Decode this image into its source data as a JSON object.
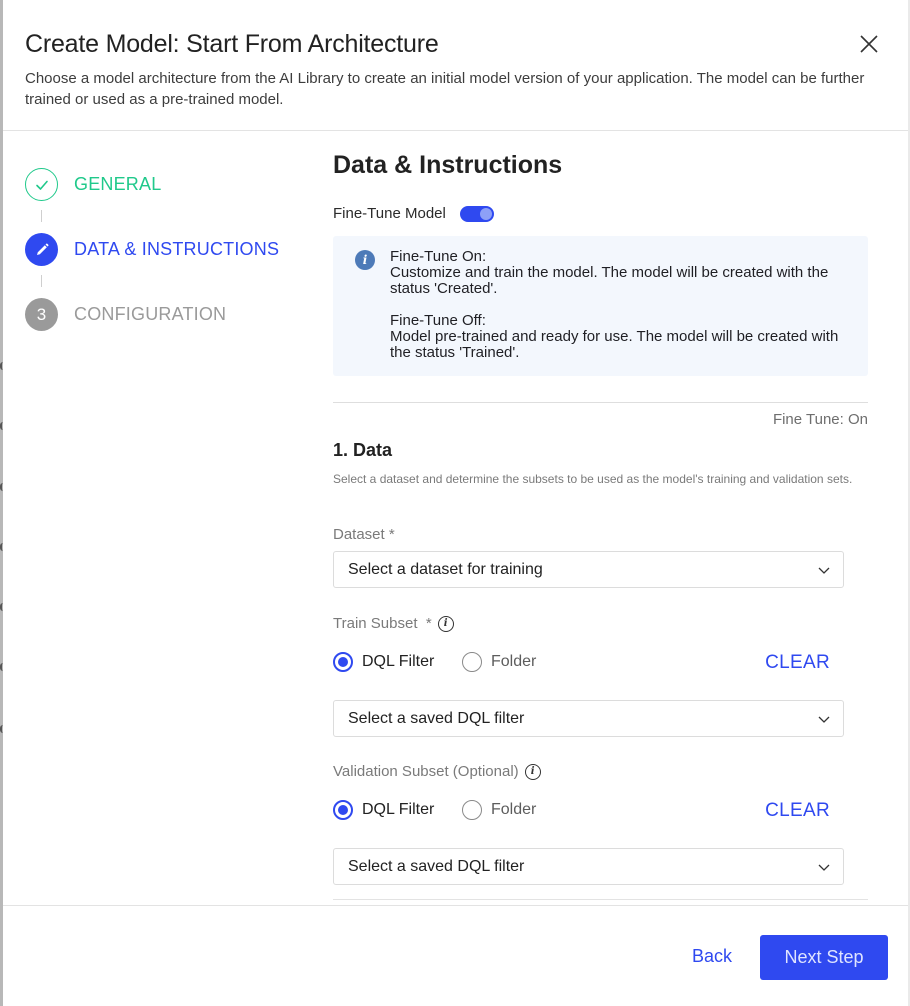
{
  "dialog": {
    "title": "Create Model: Start From Architecture",
    "subtitle": "Choose a model architecture from the AI Library to create an initial model version of your application. The model can be further trained or used as a pre-trained model.",
    "close_icon": "close-icon"
  },
  "stepper": {
    "steps": [
      {
        "label": "GENERAL",
        "state": "completed",
        "icon": "check-icon"
      },
      {
        "label": "DATA & INSTRUCTIONS",
        "state": "active",
        "icon": "pencil-icon"
      },
      {
        "label": "CONFIGURATION",
        "state": "pending",
        "number": "3"
      }
    ]
  },
  "main": {
    "section_title": "Data & Instructions",
    "fine_tune": {
      "label": "Fine-Tune Model",
      "enabled": true
    },
    "info": {
      "icon": "info-icon",
      "on_heading": "Fine-Tune On:",
      "on_text": "Customize and train the model. The model will be created with the status 'Created'.",
      "off_heading": "Fine-Tune Off:",
      "off_text": "Model pre-trained and ready for use. The model will be created with the status 'Trained'."
    },
    "fine_tune_status": "Fine Tune: On",
    "data_section": {
      "title": "1. Data",
      "description": "Select a dataset and determine the subsets to be used as the model's training and validation sets.",
      "dataset": {
        "label": "Dataset *",
        "placeholder": "Select a dataset for training"
      },
      "train_subset": {
        "label": "Train Subset  *",
        "options": [
          "DQL Filter",
          "Folder"
        ],
        "selected": "DQL Filter",
        "clear_label": "CLEAR",
        "placeholder": "Select a saved DQL filter"
      },
      "validation_subset": {
        "label": "Validation Subset (Optional)",
        "options": [
          "DQL Filter",
          "Folder"
        ],
        "selected": "DQL Filter",
        "clear_label": "CLEAR",
        "placeholder": "Select a saved DQL filter"
      }
    }
  },
  "footer": {
    "back_label": "Back",
    "next_label": "Next Step"
  },
  "colors": {
    "primary": "#2f49f0",
    "success": "#20c98b",
    "disabled": "#9a9a9a",
    "info_bg": "#f3f7fd",
    "info_icon": "#4d7ab8"
  }
}
